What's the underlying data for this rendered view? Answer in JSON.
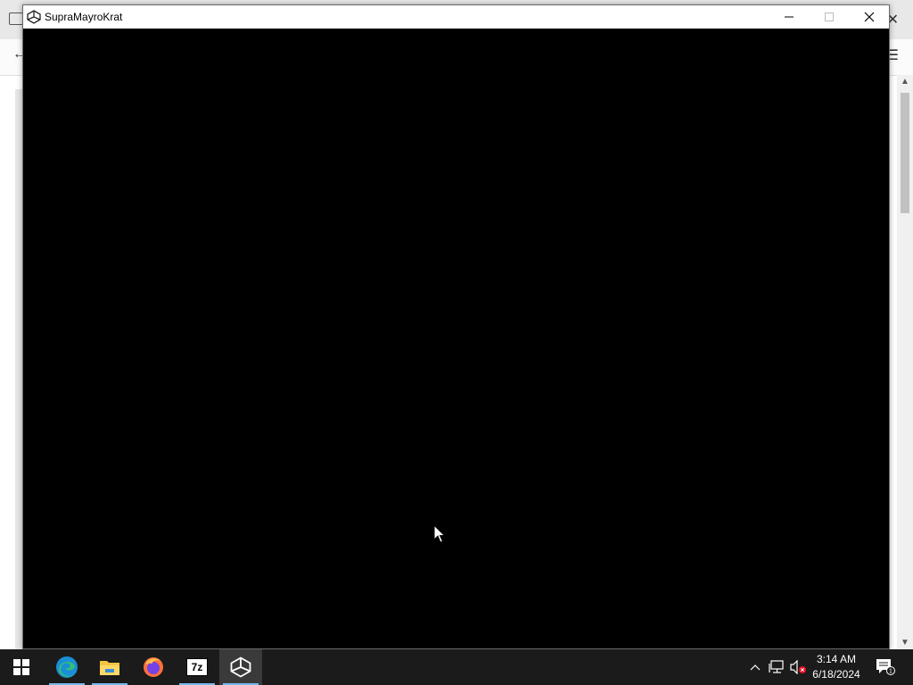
{
  "app_window": {
    "title": "SupraMayroKrat",
    "icon": "unity-icon",
    "buttons": [
      "minimize",
      "maximize",
      "close"
    ]
  },
  "taskbar": {
    "start_icon": "windows-start-icon",
    "apps": [
      {
        "name": "Microsoft Edge",
        "icon": "edge-icon"
      },
      {
        "name": "File Explorer",
        "icon": "folder-icon"
      },
      {
        "name": "Firefox",
        "icon": "firefox-icon"
      },
      {
        "name": "7-Zip",
        "icon": "7zip-icon",
        "label": "7z"
      },
      {
        "name": "SupraMayroKrat",
        "icon": "unity-icon"
      }
    ],
    "tray": {
      "chevron": "chevron-up-icon",
      "network": "network-icon",
      "volume": "volume-muted-icon",
      "time": "3:14 AM",
      "date": "6/18/2024",
      "notifications": "action-center-icon",
      "notification_count": "1"
    }
  },
  "colors": {
    "taskbar": "#1b1b1b",
    "accent": "#76b9ed",
    "game_background": "#000000"
  }
}
